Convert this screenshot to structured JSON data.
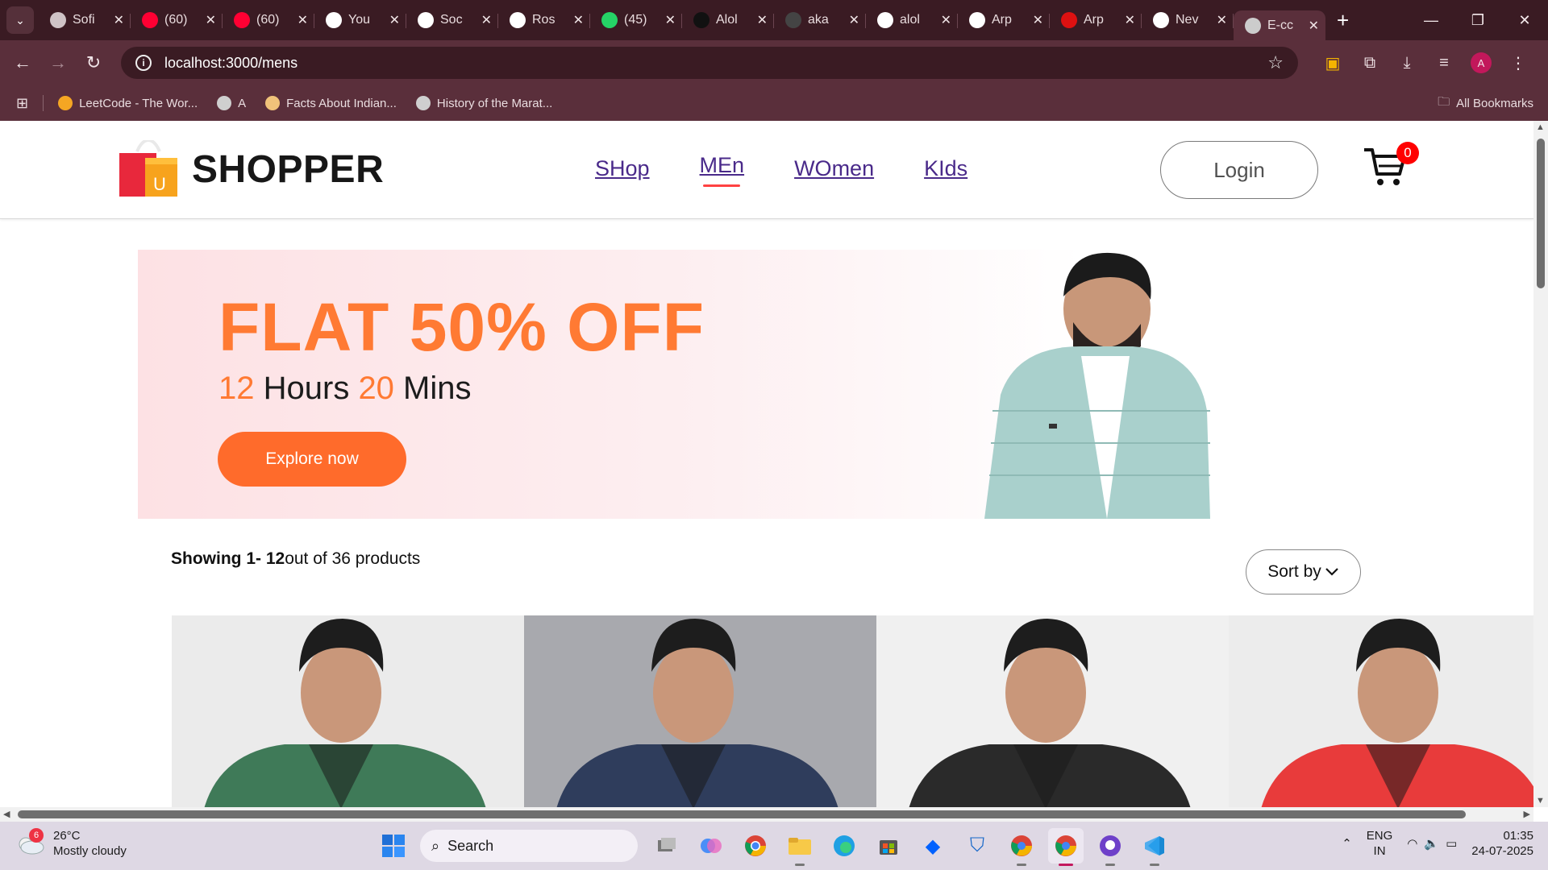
{
  "browser": {
    "tabs": [
      {
        "title": "Sofi",
        "favicon": "openai-like-icon",
        "color": "#cfc3c6"
      },
      {
        "title": "(60)",
        "favicon": "youtube-icon",
        "color": "#ff0033"
      },
      {
        "title": "(60)",
        "favicon": "youtube-icon",
        "color": "#ff0033"
      },
      {
        "title": "You",
        "favicon": "github-icon",
        "color": "#ffffff"
      },
      {
        "title": "Soc",
        "favicon": "chatgpt-icon",
        "color": "#ffffff"
      },
      {
        "title": "Ros",
        "favicon": "wikipedia-icon",
        "color": "#ffffff"
      },
      {
        "title": "(45)",
        "favicon": "whatsapp-icon",
        "color": "#25d366"
      },
      {
        "title": "Alol",
        "favicon": "site-icon",
        "color": "#111111"
      },
      {
        "title": "aka",
        "favicon": "loading-icon",
        "color": "#444444"
      },
      {
        "title": "alol",
        "favicon": "github-icon",
        "color": "#ffffff"
      },
      {
        "title": "Arp",
        "favicon": "github-icon",
        "color": "#ffffff"
      },
      {
        "title": "Arp",
        "favicon": "ap-icon",
        "color": "#d11"
      },
      {
        "title": "Nev",
        "favicon": "chrome-icon",
        "color": "#ffffff"
      },
      {
        "title": "E-cc",
        "favicon": "globe-icon",
        "color": "#cccccc",
        "active": true
      }
    ],
    "url": "localhost:3000/mens",
    "profile_initial": "A",
    "bookmarks": [
      {
        "label": "LeetCode - The Wor...",
        "icon": "leetcode-icon"
      },
      {
        "label": "A",
        "icon": "globe-icon"
      },
      {
        "label": "Facts About Indian...",
        "icon": "site-icon"
      },
      {
        "label": "History of the Marat...",
        "icon": "globe-icon"
      }
    ],
    "all_bookmarks": "All Bookmarks"
  },
  "site": {
    "logo_text": "SHOPPER",
    "logo_badge": "U",
    "menu": [
      {
        "label": "SHop",
        "active": false
      },
      {
        "label": "MEn",
        "active": true
      },
      {
        "label": "WOmen",
        "active": false
      },
      {
        "label": "KIds",
        "active": false
      }
    ],
    "login_label": "Login",
    "cart_count": "0",
    "accent": "#ff4141"
  },
  "banner": {
    "headline": "FLAT 50% OFF",
    "hours_num": "12",
    "hours_label": " Hours ",
    "mins_num": "20",
    "mins_label": " Mins",
    "button_label": "Explore now",
    "accent": "#ff6b2b"
  },
  "listing": {
    "showing_bold": "Showing 1- 12",
    "showing_rest": "out of 36 products",
    "sort_label": "Sort by"
  },
  "products": [
    {
      "name": "green-hoodie",
      "bg": "#ebebeb",
      "garment": "#3f7a58"
    },
    {
      "name": "navy-jacket",
      "bg": "#a8a9ae",
      "garment": "#2f3d5c"
    },
    {
      "name": "printed-bomber",
      "bg": "#f0f0f0",
      "garment": "#2a2a2a"
    },
    {
      "name": "red-jacket",
      "bg": "#ececec",
      "garment": "#e83b3b"
    }
  ],
  "taskbar": {
    "weather_temp": "26°C",
    "weather_desc": "Mostly cloudy",
    "weather_badge": "6",
    "search_label": "Search",
    "lang_top": "ENG",
    "lang_bottom": "IN",
    "time": "01:35",
    "date": "24-07-2025"
  }
}
